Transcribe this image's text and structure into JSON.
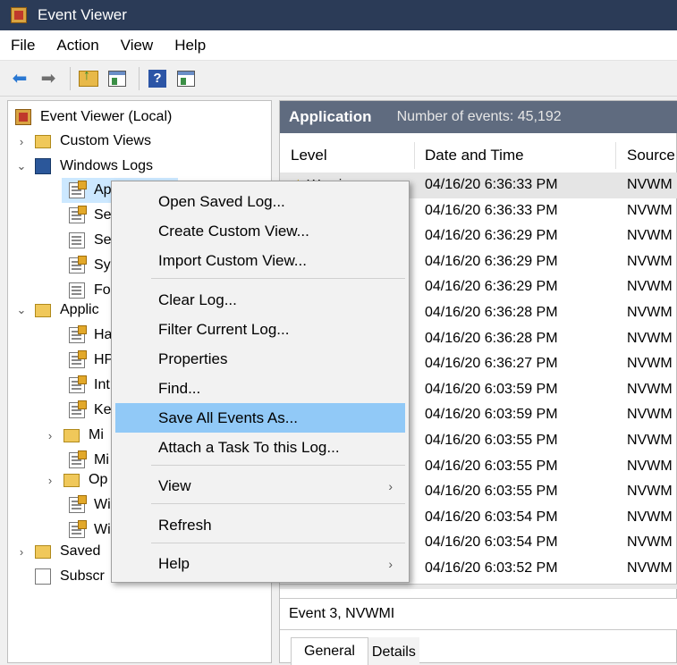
{
  "window": {
    "title": "Event Viewer"
  },
  "menubar": {
    "items": [
      "File",
      "Action",
      "View",
      "Help"
    ]
  },
  "toolbar": {
    "icons": [
      "back-arrow-icon",
      "forward-arrow-icon",
      "up-folder-icon",
      "show-hide-tree-icon",
      "help-icon",
      "show-hide-action-pane-icon"
    ]
  },
  "tree": {
    "items": [
      {
        "label": "Event Viewer (Local)"
      },
      {
        "label": "Custom Views"
      },
      {
        "label": "Windows Logs"
      },
      {
        "label": "Ap"
      },
      {
        "label": "Se"
      },
      {
        "label": "Se"
      },
      {
        "label": "Sy"
      },
      {
        "label": "Fo"
      },
      {
        "label": "Applic"
      },
      {
        "label": "Ha"
      },
      {
        "label": "HP"
      },
      {
        "label": "Int"
      },
      {
        "label": "Ke"
      },
      {
        "label": "Mi"
      },
      {
        "label": "Mi"
      },
      {
        "label": "Op"
      },
      {
        "label": "Wi"
      },
      {
        "label": "Wi"
      },
      {
        "label": "Saved"
      },
      {
        "label": "Subscr"
      }
    ]
  },
  "pane": {
    "name": "Application",
    "count": "Number of events: 45,192"
  },
  "grid": {
    "columns": [
      "Level",
      "Date and Time",
      "Source"
    ],
    "first_level": "Warning",
    "rows": [
      {
        "dt": "04/16/20 6:36:33 PM",
        "src": "NVWM"
      },
      {
        "dt": "04/16/20 6:36:33 PM",
        "src": "NVWM"
      },
      {
        "dt": "04/16/20 6:36:29 PM",
        "src": "NVWM"
      },
      {
        "dt": "04/16/20 6:36:29 PM",
        "src": "NVWM"
      },
      {
        "dt": "04/16/20 6:36:29 PM",
        "src": "NVWM"
      },
      {
        "dt": "04/16/20 6:36:28 PM",
        "src": "NVWM"
      },
      {
        "dt": "04/16/20 6:36:28 PM",
        "src": "NVWM"
      },
      {
        "dt": "04/16/20 6:36:27 PM",
        "src": "NVWM"
      },
      {
        "dt": "04/16/20 6:03:59 PM",
        "src": "NVWM"
      },
      {
        "dt": "04/16/20 6:03:59 PM",
        "src": "NVWM"
      },
      {
        "dt": "04/16/20 6:03:55 PM",
        "src": "NVWM"
      },
      {
        "dt": "04/16/20 6:03:55 PM",
        "src": "NVWM"
      },
      {
        "dt": "04/16/20 6:03:55 PM",
        "src": "NVWM"
      },
      {
        "dt": "04/16/20 6:03:54 PM",
        "src": "NVWM"
      },
      {
        "dt": "04/16/20 6:03:54 PM",
        "src": "NVWM"
      },
      {
        "dt": "04/16/20 6:03:52 PM",
        "src": "NVWM"
      }
    ]
  },
  "detail": {
    "title": "Event 3, NVWMI",
    "tabs": [
      "General",
      "Details"
    ]
  },
  "context_menu": {
    "items": [
      {
        "label": "Open Saved Log..."
      },
      {
        "label": "Create Custom View..."
      },
      {
        "label": "Import Custom View..."
      },
      {
        "label": "Clear Log..."
      },
      {
        "label": "Filter Current Log..."
      },
      {
        "label": "Properties"
      },
      {
        "label": "Find..."
      },
      {
        "label": "Save All Events As...",
        "highlighted": true
      },
      {
        "label": "Attach a Task To this Log..."
      },
      {
        "label": "View",
        "submenu": true
      },
      {
        "label": "Refresh"
      },
      {
        "label": "Help",
        "submenu": true
      }
    ],
    "submenu_arrow": "›"
  },
  "colors": {
    "titlebar": "#2b3b57",
    "pane_header": "#5f6b7f",
    "menu_highlight": "#91c9f7",
    "selection": "#cce8ff"
  }
}
